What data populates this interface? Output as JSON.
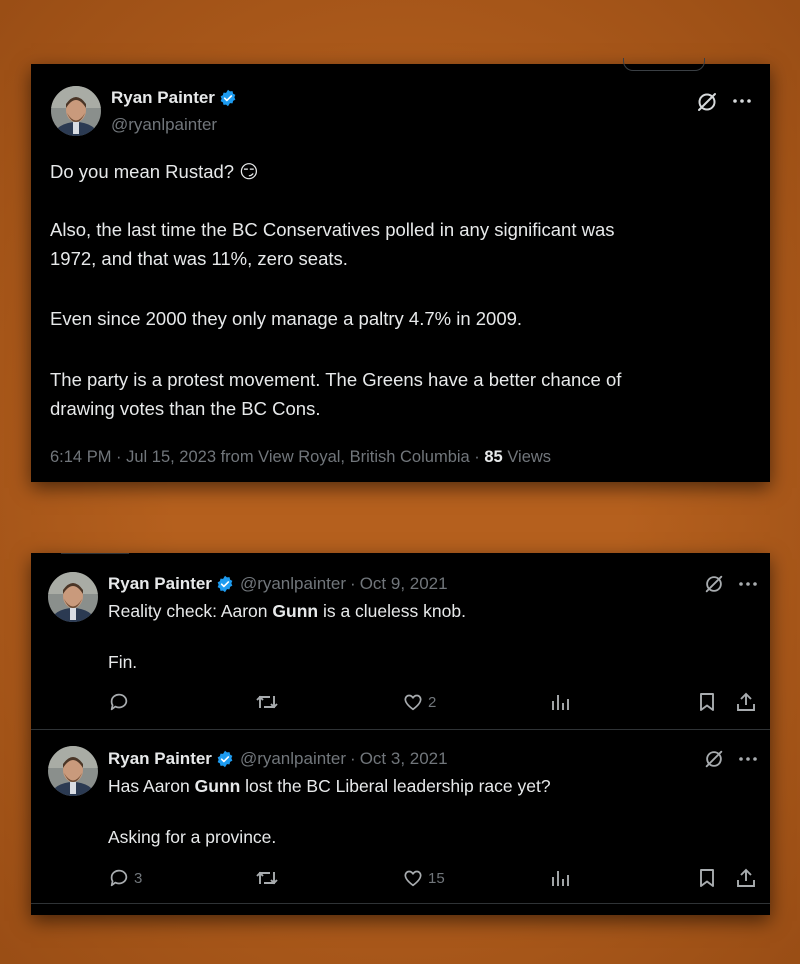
{
  "tweet_main": {
    "name": "Ryan Painter",
    "handle": "@ryanlpainter",
    "line1_text": "Do you mean Rustad? ",
    "line1_emoji": "😏",
    "para2": "Also, the last time the BC Conservatives polled in any significant was\n1972, and that was 11%, zero seats.",
    "para3": "Even since 2000 they only manage a paltry 4.7% in 2009.",
    "para4": "The party is a protest movement. The Greens have a better chance of\ndrawing votes than the BC Cons.",
    "timestamp": "6:14 PM · Jul 15, 2023 from View Royal, British Columbia · ",
    "views_count": "85",
    "views_label": " Views"
  },
  "reply1": {
    "name": "Ryan Painter",
    "handle": "@ryanlpainter",
    "dot": "·",
    "date": "Oct 9, 2021",
    "text_before": "Reality check: Aaron ",
    "text_bold": "Gunn",
    "text_after": " is a clueless knob.",
    "text2": "Fin.",
    "replies": "",
    "likes": "2"
  },
  "reply2": {
    "name": "Ryan Painter",
    "handle": "@ryanlpainter",
    "dot": "·",
    "date": "Oct 3, 2021",
    "text_before": "Has Aaron ",
    "text_bold": "Gunn",
    "text_after": " lost the BC Liberal leadership race yet?",
    "text2": "Asking for a province.",
    "replies": "3",
    "likes": "15"
  },
  "icons": {
    "grok": "grok-icon",
    "more": "more-icon",
    "reply": "reply-icon",
    "retweet": "retweet-icon",
    "like": "like-icon",
    "views": "views-icon",
    "bookmark": "bookmark-icon",
    "share": "share-icon",
    "verified": "verified-badge-icon"
  },
  "colors": {
    "background": "#b5601e",
    "panel": "#000000",
    "text": "#e7e9ea",
    "muted": "#71767b",
    "verified": "#1d9bf0"
  }
}
